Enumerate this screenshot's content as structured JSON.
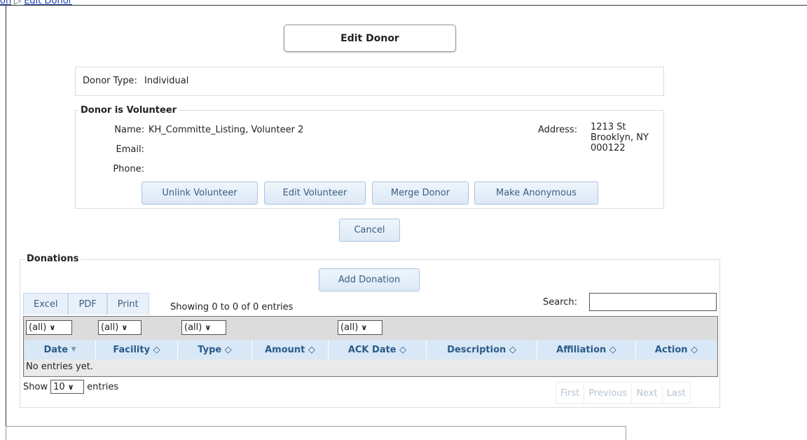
{
  "breadcrumb": {
    "prev_label": "on",
    "separator": "▷",
    "current_label": "Edit Donor"
  },
  "page_title": "Edit Donor",
  "donor_type": {
    "label": "Donor Type:",
    "value": "Individual"
  },
  "volunteer": {
    "legend": "Donor is Volunteer",
    "name_label": "Name:",
    "name_value": "KH_Committe_Listing, Volunteer 2",
    "email_label": "Email:",
    "email_value": "",
    "phone_label": "Phone:",
    "phone_value": "",
    "address_label": "Address:",
    "address_lines": [
      "1213 St",
      "Brooklyn, NY",
      "000122"
    ],
    "buttons": {
      "unlink": "Unlink Volunteer",
      "edit": "Edit Volunteer",
      "merge": "Merge Donor",
      "anonymous": "Make Anonymous"
    }
  },
  "cancel_label": "Cancel",
  "donations": {
    "legend": "Donations",
    "add_label": "Add Donation",
    "export_tabs": [
      "Excel",
      "PDF",
      "Print"
    ],
    "showing_text": "Showing 0 to 0 of 0 entries",
    "search_label": "Search:",
    "search_value": "",
    "filters": [
      "(all)",
      "(all)",
      "(all)",
      "(all)"
    ],
    "columns": [
      "Date",
      "Facility",
      "Type",
      "Amount",
      "ACK Date",
      "Description",
      "Affiliation",
      "Action"
    ],
    "empty_text": "No entries yet.",
    "show_label": "Show",
    "page_size": "10",
    "entries_label": "entries",
    "pager": [
      "First",
      "Previous",
      "Next",
      "Last"
    ]
  },
  "icons": {
    "sort_desc": "▼",
    "sort_both": "◇",
    "chevron": "∨"
  },
  "colors": {
    "link": "#1a3fb0",
    "button_text": "#3b5e80",
    "header_bg": "#d8e8f6",
    "header_text": "#2b5a8a"
  }
}
